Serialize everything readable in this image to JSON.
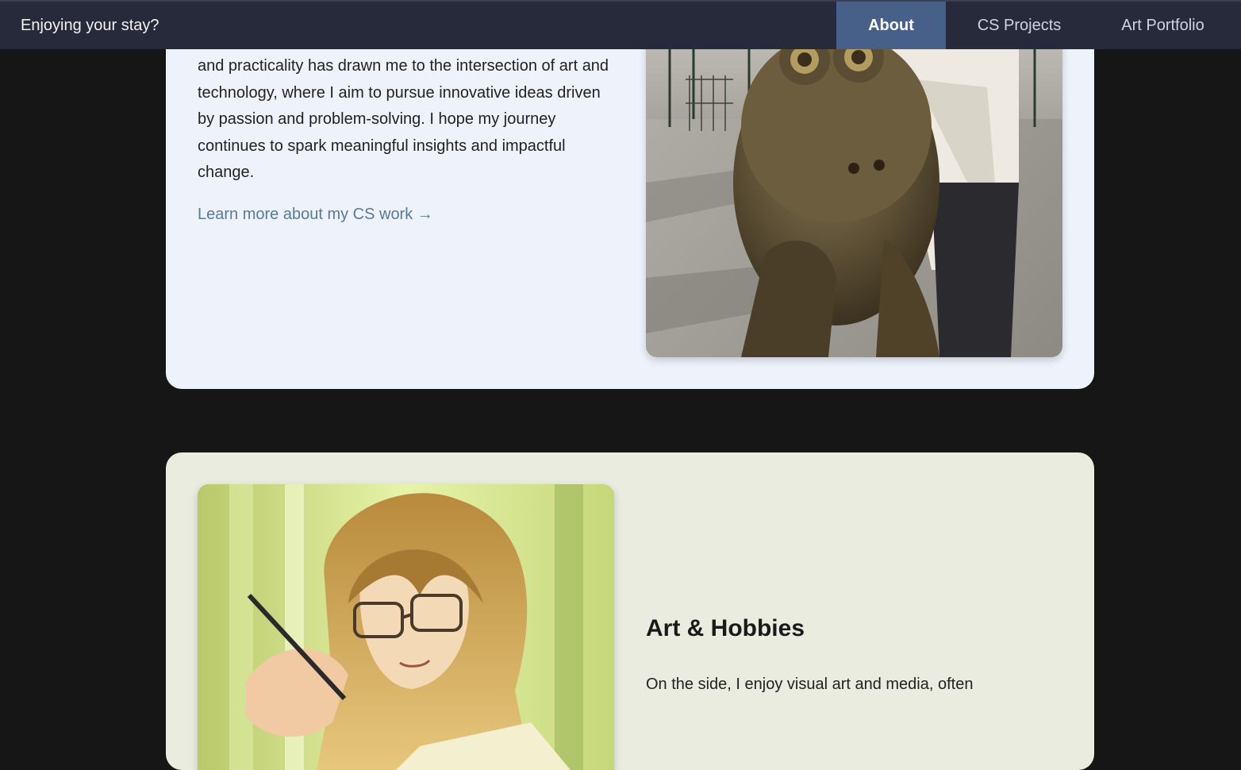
{
  "nav": {
    "brand": "Enjoying your stay?",
    "links": [
      {
        "label": "About",
        "active": true
      },
      {
        "label": "CS Projects",
        "active": false
      },
      {
        "label": "Art Portfolio",
        "active": false
      }
    ]
  },
  "cs_section": {
    "paragraph": "and practicality has drawn me to the intersection of art and technology, where I aim to pursue innovative ideas driven by passion and problem-solving. I hope my journey continues to spark meaningful insights and impactful change.",
    "link": "Learn more about my CS work →"
  },
  "art_section": {
    "heading": "Art & Hobbies",
    "paragraph": "On the side, I enjoy visual art and media, often"
  },
  "colors": {
    "page_background": "#161616",
    "nav_background": "#262a3b",
    "nav_active": "#46608a",
    "cs_card": "#eef2fb",
    "art_card": "#e9ecdf",
    "link": "#58799a"
  }
}
